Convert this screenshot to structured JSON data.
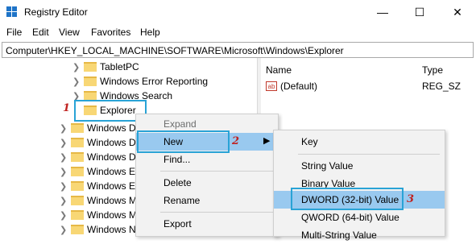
{
  "window": {
    "title": "Registry Editor",
    "minimize": "—",
    "maximize": "☐",
    "close": "✕"
  },
  "menubar": {
    "items": [
      "File",
      "Edit",
      "View",
      "Favorites",
      "Help"
    ]
  },
  "address": "Computer\\HKEY_LOCAL_MACHINE\\SOFTWARE\\Microsoft\\Windows\\Explorer",
  "tree": {
    "items": [
      "TabletPC",
      "Windows Error Reporting",
      "Windows Search",
      "Explorer",
      "Windows De",
      "Windows De",
      "Windows Do",
      "Windows Em",
      "Windows Em",
      "Windows M",
      "Windows M",
      "Windows Na"
    ]
  },
  "list": {
    "headers": {
      "name": "Name",
      "type": "Type"
    },
    "rows": [
      {
        "icon": "ab",
        "name": "(Default)",
        "type": "REG_SZ"
      }
    ]
  },
  "context_menu": {
    "items": [
      "Expand",
      "New",
      "Find...",
      "Delete",
      "Rename",
      "Export"
    ]
  },
  "submenu": {
    "items": [
      "Key",
      "String Value",
      "Binary Value",
      "DWORD (32-bit) Value",
      "QWORD (64-bit) Value",
      "Multi-String Value"
    ]
  },
  "steps": [
    "1",
    "2",
    "3"
  ],
  "colors": {
    "annotation_box": "#29a3d6",
    "annotation_number": "#c0211f",
    "selection": "#99c9ef",
    "folder": "#f8d775"
  }
}
